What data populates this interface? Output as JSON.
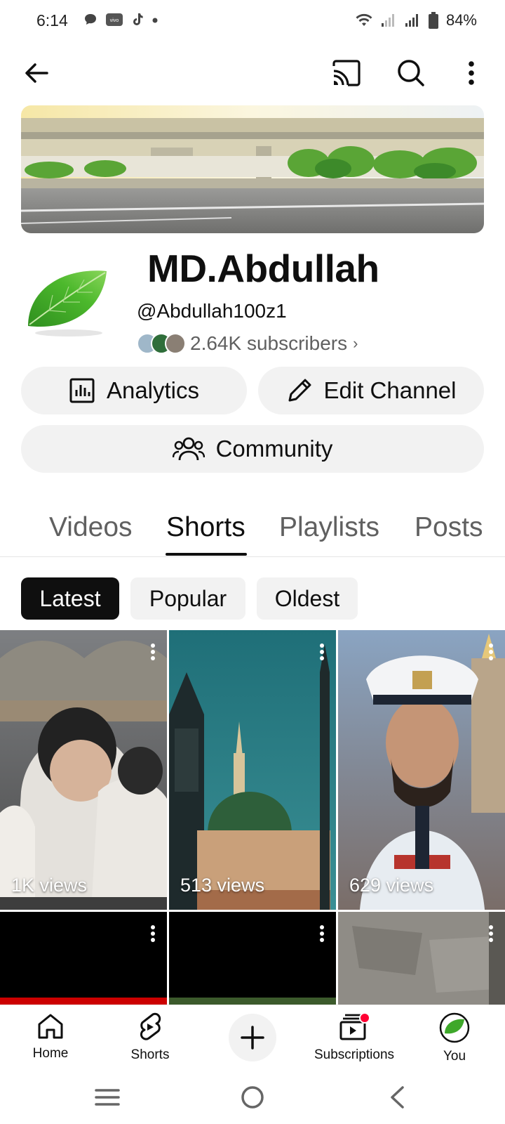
{
  "status_bar": {
    "time": "6:14",
    "battery": "84%",
    "notification_icons": [
      "chat-bubble-icon",
      "vivo-icon",
      "tiktok-icon",
      "dot-icon"
    ],
    "system_icons": [
      "wifi-icon",
      "signal-weak-icon",
      "signal-icon",
      "battery-icon"
    ]
  },
  "app_bar": {
    "icons": [
      "back-arrow-icon",
      "cast-icon",
      "search-icon",
      "more-vert-icon"
    ]
  },
  "channel": {
    "name": "MD.Abdullah",
    "handle": "@Abdullah100z1",
    "subscribers": "2.64K subscribers",
    "subscribers_chevron": "›"
  },
  "actions": {
    "analytics": "Analytics",
    "edit_channel": "Edit Channel",
    "community": "Community"
  },
  "tabs": [
    {
      "label": "Videos",
      "active": false
    },
    {
      "label": "Shorts",
      "active": true
    },
    {
      "label": "Playlists",
      "active": false
    },
    {
      "label": "Posts",
      "active": false
    }
  ],
  "filters": [
    {
      "label": "Latest",
      "active": true
    },
    {
      "label": "Popular",
      "active": false
    },
    {
      "label": "Oldest",
      "active": false
    }
  ],
  "shorts": [
    {
      "views": "1K views"
    },
    {
      "views": "513 views"
    },
    {
      "views": "629 views"
    },
    {
      "views": ""
    },
    {
      "views": ""
    },
    {
      "views": ""
    }
  ],
  "bottom_nav": [
    {
      "label": "Home",
      "icon": "home-icon"
    },
    {
      "label": "Shorts",
      "icon": "shorts-icon"
    },
    {
      "label": "",
      "icon": "create-plus-icon"
    },
    {
      "label": "Subscriptions",
      "icon": "subscriptions-icon"
    },
    {
      "label": "You",
      "icon": "you-avatar-icon"
    }
  ],
  "colors": {
    "text_primary": "#0f0f0f",
    "text_secondary": "#606060",
    "chip_bg": "#f2f2f2",
    "notification_dot": "#ff0033"
  }
}
